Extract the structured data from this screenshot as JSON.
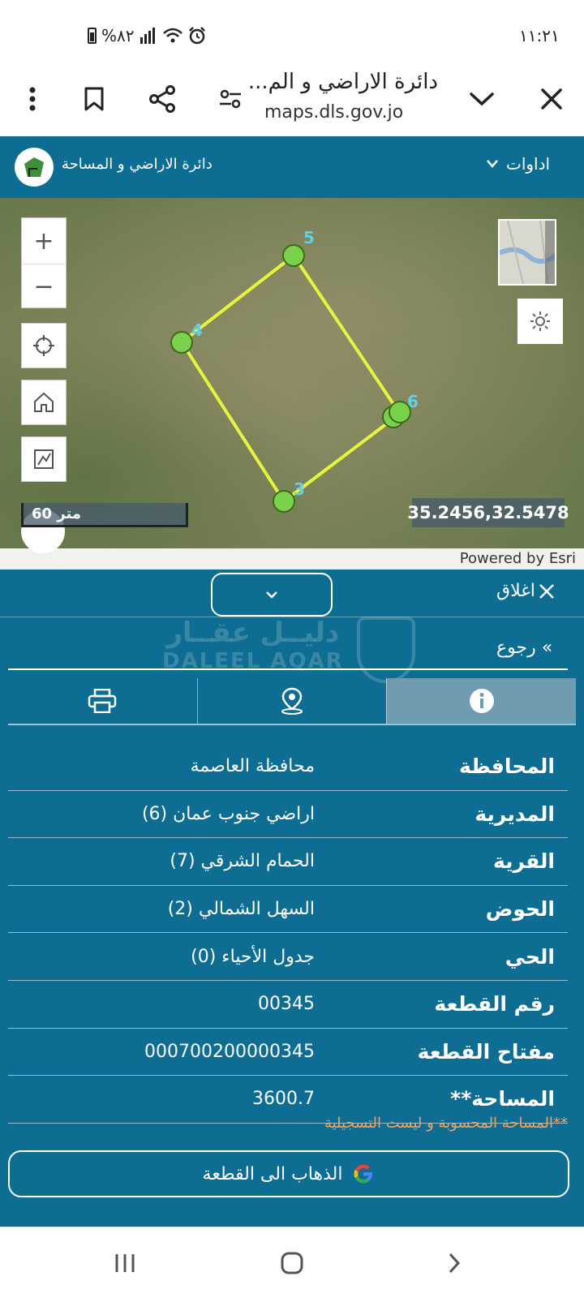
{
  "status": {
    "time": "١١:٢١",
    "battery": "%٨٢"
  },
  "browser": {
    "title": "دائرة الاراضي و الم...",
    "url": "maps.dls.gov.jo"
  },
  "header": {
    "site_name": "دائرة الاراضي و المساحة",
    "tools_label": "اداوات"
  },
  "map": {
    "scale_label": "60 متر",
    "coordinates": "35.2456,32.5478",
    "attribution": "Powered by Esri",
    "vertex_labels": [
      "5",
      "4",
      "6",
      "3"
    ]
  },
  "panel": {
    "close_label": "اغلاق",
    "back_label": "رجوع",
    "watermark_ar": "دليــل عقــار",
    "watermark_en": "DALEEL AQAR",
    "rows": [
      {
        "label": "المحافظة",
        "value": "محافظة العاصمة"
      },
      {
        "label": "المديرية",
        "value": "اراضي جنوب عمان (6)"
      },
      {
        "label": "القرية",
        "value": "الحمام الشرقي (7)"
      },
      {
        "label": "الحوض",
        "value": "السهل الشمالي (2)"
      },
      {
        "label": "الحي",
        "value": "جدول الأحياء (0)"
      },
      {
        "label": "رقم القطعة",
        "value": "00345"
      },
      {
        "label": "مفتاح القطعة",
        "value": "000700200000345"
      },
      {
        "label": "المساحة**",
        "value": "3600.7"
      }
    ],
    "note": "**المساحة المحسوبة و ليست التسجيلية",
    "goto_label": "الذهاب الى القطعة"
  },
  "colors": {
    "primary": "#0e6d92",
    "parcel_line": "#e6f53a",
    "vertex_fill": "#7ad14a",
    "note": "#f4a261"
  }
}
